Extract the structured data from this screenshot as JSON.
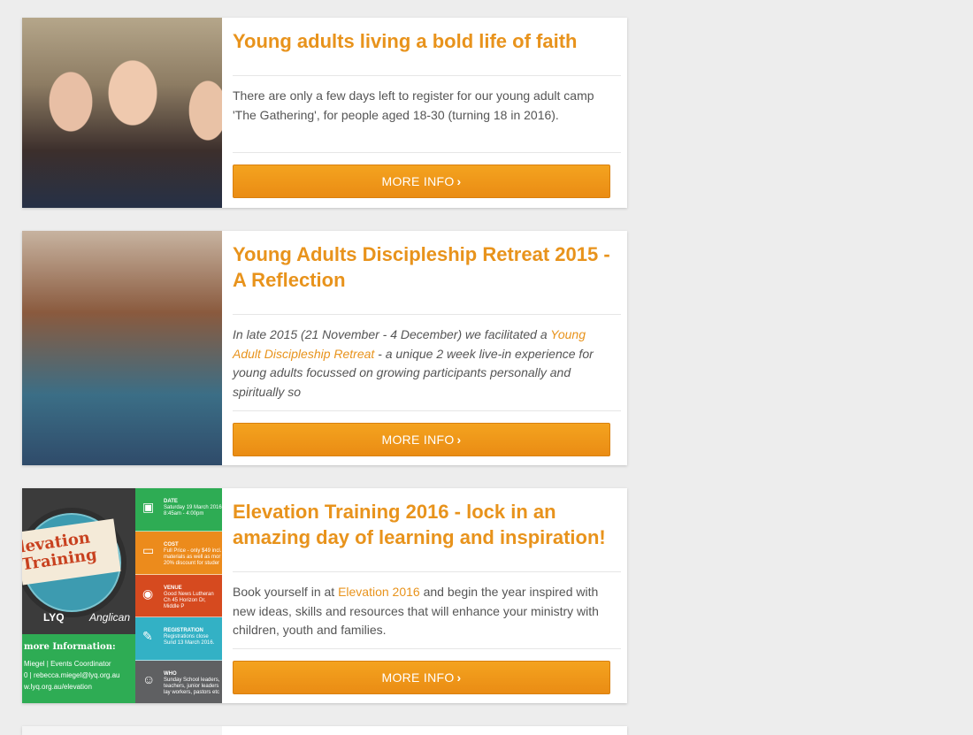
{
  "cards": [
    {
      "title": "Young adults living a bold life of faith",
      "excerpt": "There are only a few days left to register for our young adult camp 'The Gathering', for people aged 18-30 (turning 18 in 2016).",
      "button": "MORE INFO"
    },
    {
      "title": "Young Adults Discipleship Retreat 2015 - A Reflection",
      "excerpt_prefix": "In late 2015 (21 November - 4 December) we facilitated a ",
      "excerpt_link": "Young Adult Discipleship Retreat",
      "excerpt_suffix": " - a unique 2 week live-in experience for young adults focussed on growing participants personally and spiritually so",
      "button": "MORE INFO"
    },
    {
      "title": "Elevation Training 2016 - lock in an amazing day of learning and inspiration!",
      "excerpt_prefix": "Book yourself in at ",
      "excerpt_link": "Elevation 2016",
      "excerpt_suffix": " and begin the year inspired with new ideas, skills and resources that will enhance your ministry with children, youth and families.",
      "button": "MORE INFO",
      "poster": {
        "banner_line1": "levation",
        "banner_line2": "Training",
        "logo": "LYQ",
        "logo2": "Anglican",
        "more_info": "more Information:",
        "contact1": "Miegel | Events Coordinator",
        "contact2": "0 | rebecca.miegel@lyq.org.au",
        "contact3": "w.lyq.org.au/elevation",
        "strips": [
          {
            "label": "DATE",
            "text": "Saturday 19 March 2016 8:45am - 4:00pm",
            "color": "#2eac54"
          },
          {
            "label": "COST",
            "text": "Full Price - only $49 incl. materials as well as mor 20% discount for studer",
            "color": "#ec8b1c"
          },
          {
            "label": "VENUE",
            "text": "Good News Lutheran Ch 45 Horizon Dr, Middle P",
            "color": "#d64a1f"
          },
          {
            "label": "REGISTRATION",
            "text": "Registrations close Sund 13 March 2016.",
            "color": "#33b1c5"
          },
          {
            "label": "WHO",
            "text": "Sunday School leaders, teachers, junior leaders lay workers, pastors etc",
            "color": "#5f6062"
          }
        ]
      }
    }
  ],
  "colors": {
    "accent": "#e8931c",
    "button": "#f09a1c",
    "background": "#ededed"
  }
}
